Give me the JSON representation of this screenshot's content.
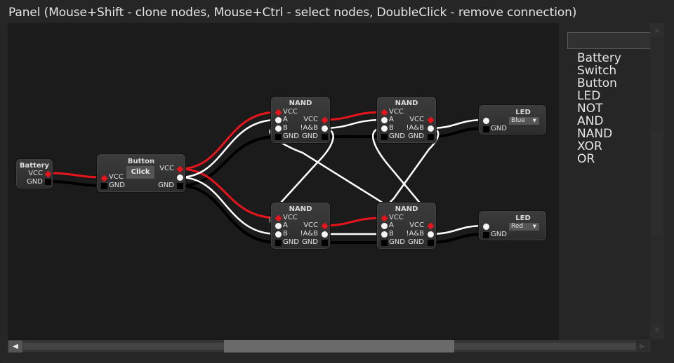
{
  "window": {
    "title": "Panel (Mouse+Shift - clone nodes, Mouse+Ctrl - select nodes, DoubleClick - remove connection)"
  },
  "colors": {
    "power_wire": "#e8141c",
    "signal_wire": "#ffffff",
    "ground_wire": "#000000",
    "canvas_bg": "#1b1b1b"
  },
  "nodes": {
    "battery": {
      "title": "Battery",
      "vcc": "VCC",
      "gnd": "GND"
    },
    "button": {
      "title": "Button",
      "click_label": "Click",
      "vcc_in": "VCC",
      "gnd_in": "GND",
      "vcc_out": "VCC",
      "gnd_out": "GND"
    },
    "nand1": {
      "title": "NAND",
      "vcc_in": "VCC",
      "a": "A",
      "b": "B",
      "gnd_in": "GND",
      "vcc_out": "VCC",
      "out": "!A&B",
      "gnd_out": "GND"
    },
    "nand2": {
      "title": "NAND",
      "vcc_in": "VCC",
      "a": "A",
      "b": "B",
      "gnd_in": "GND",
      "vcc_out": "VCC",
      "out": "!A&B",
      "gnd_out": "GND"
    },
    "nand3": {
      "title": "NAND",
      "vcc_in": "VCC",
      "a": "A",
      "b": "B",
      "gnd_in": "GND",
      "vcc_out": "VCC",
      "out": "!A&B",
      "gnd_out": "GND"
    },
    "nand4": {
      "title": "NAND",
      "vcc_in": "VCC",
      "a": "A",
      "b": "B",
      "gnd_in": "GND",
      "vcc_out": "VCC",
      "out": "!A&B",
      "gnd_out": "GND"
    },
    "led1": {
      "title": "LED",
      "gnd": "GND",
      "color": "Blue"
    },
    "led2": {
      "title": "LED",
      "gnd": "GND",
      "color": "Red"
    }
  },
  "sidebar": {
    "search_value": "",
    "items": [
      "Battery",
      "Switch",
      "Button",
      "LED",
      "NOT",
      "AND",
      "NAND",
      "XOR",
      "OR"
    ]
  },
  "scrollbars": {
    "horizontal": {
      "left_arrow": "◀",
      "right_arrow": "▶"
    },
    "vertical": {
      "up_arrow": "▲",
      "down_arrow": "▼"
    }
  }
}
